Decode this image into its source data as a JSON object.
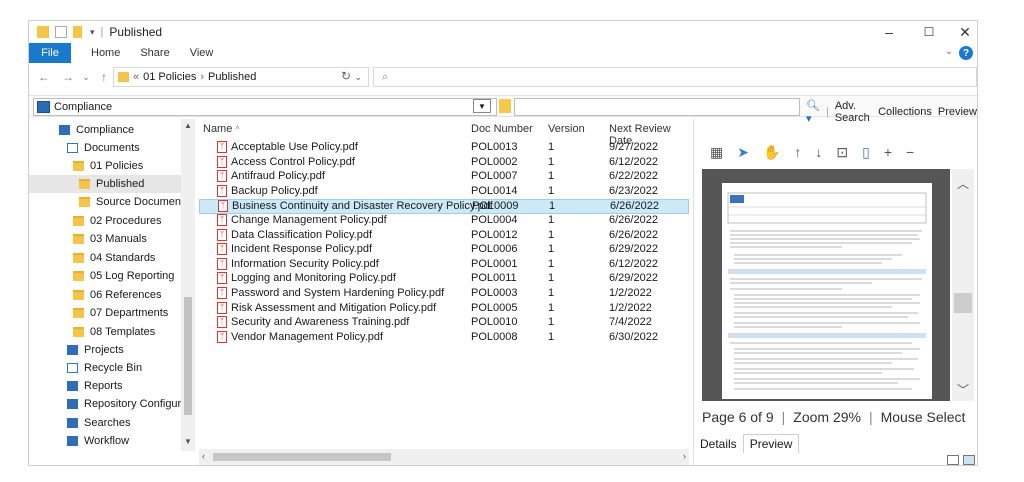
{
  "window": {
    "title": "Published"
  },
  "ribbon": {
    "tabs": [
      "File",
      "Home",
      "Share",
      "View"
    ]
  },
  "address": {
    "root": "01 Policies",
    "current": "Published",
    "prefix": "«"
  },
  "toolbar": {
    "location": "Compliance",
    "adv_search": "Adv. Search",
    "collections": "Collections",
    "preview": "Preview"
  },
  "nav": {
    "items": [
      {
        "label": "Compliance",
        "icon": "repository-icon"
      },
      {
        "label": "Documents",
        "icon": "documents-icon"
      },
      {
        "label": "01 Policies",
        "icon": "folder-icon"
      },
      {
        "label": "Published",
        "icon": "folder-icon"
      },
      {
        "label": "Source Documents",
        "icon": "folder-icon"
      },
      {
        "label": "02 Procedures",
        "icon": "folder-icon"
      },
      {
        "label": "03 Manuals",
        "icon": "folder-icon"
      },
      {
        "label": "04 Standards",
        "icon": "folder-icon"
      },
      {
        "label": "05 Log Reporting",
        "icon": "folder-icon"
      },
      {
        "label": "06 References",
        "icon": "folder-icon"
      },
      {
        "label": "07 Departments",
        "icon": "folder-icon"
      },
      {
        "label": "08 Templates",
        "icon": "folder-icon"
      },
      {
        "label": "Projects",
        "icon": "projects-icon"
      },
      {
        "label": "Recycle Bin",
        "icon": "recycle-bin-icon"
      },
      {
        "label": "Reports",
        "icon": "reports-icon"
      },
      {
        "label": "Repository Configuration",
        "icon": "config-icon"
      },
      {
        "label": "Searches",
        "icon": "searches-icon"
      },
      {
        "label": "Workflow",
        "icon": "workflow-icon"
      }
    ]
  },
  "files": {
    "headers": [
      "Name",
      "Doc Number",
      "Version",
      "Next Review Date"
    ],
    "rows": [
      {
        "name": "Acceptable Use Policy.pdf",
        "doc": "POL0013",
        "version": "1",
        "date": "9/27/2022"
      },
      {
        "name": "Access Control Policy.pdf",
        "doc": "POL0002",
        "version": "1",
        "date": "6/12/2022"
      },
      {
        "name": "Antifraud Policy.pdf",
        "doc": "POL0007",
        "version": "1",
        "date": "6/22/2022"
      },
      {
        "name": "Backup Policy.pdf",
        "doc": "POL0014",
        "version": "1",
        "date": "6/23/2022"
      },
      {
        "name": "Business Continuity and Disaster Recovery Policy.pdf",
        "doc": "POL0009",
        "version": "1",
        "date": "6/26/2022"
      },
      {
        "name": "Change Management Policy.pdf",
        "doc": "POL0004",
        "version": "1",
        "date": "6/26/2022"
      },
      {
        "name": "Data Classification Policy.pdf",
        "doc": "POL0012",
        "version": "1",
        "date": "6/26/2022"
      },
      {
        "name": "Incident Response Policy.pdf",
        "doc": "POL0006",
        "version": "1",
        "date": "6/29/2022"
      },
      {
        "name": "Information Security Policy.pdf",
        "doc": "POL0001",
        "version": "1",
        "date": "6/12/2022"
      },
      {
        "name": "Logging and Monitoring Policy.pdf",
        "doc": "POL0011",
        "version": "1",
        "date": "6/29/2022"
      },
      {
        "name": "Password and System Hardening Policy.pdf",
        "doc": "POL0003",
        "version": "1",
        "date": "1/2/2022"
      },
      {
        "name": "Risk Assessment and Mitigation Policy.pdf",
        "doc": "POL0005",
        "version": "1",
        "date": "1/2/2022"
      },
      {
        "name": "Security and Awareness Training.pdf",
        "doc": "POL0010",
        "version": "1",
        "date": "7/4/2022"
      },
      {
        "name": "Vendor Management Policy.pdf",
        "doc": "POL0008",
        "version": "1",
        "date": "6/30/2022"
      }
    ]
  },
  "preview": {
    "page_text": "Page 6 of 9",
    "zoom_text": "Zoom 29%",
    "mode_text": "Mouse Select",
    "tabs": [
      "Details",
      "Preview"
    ]
  }
}
